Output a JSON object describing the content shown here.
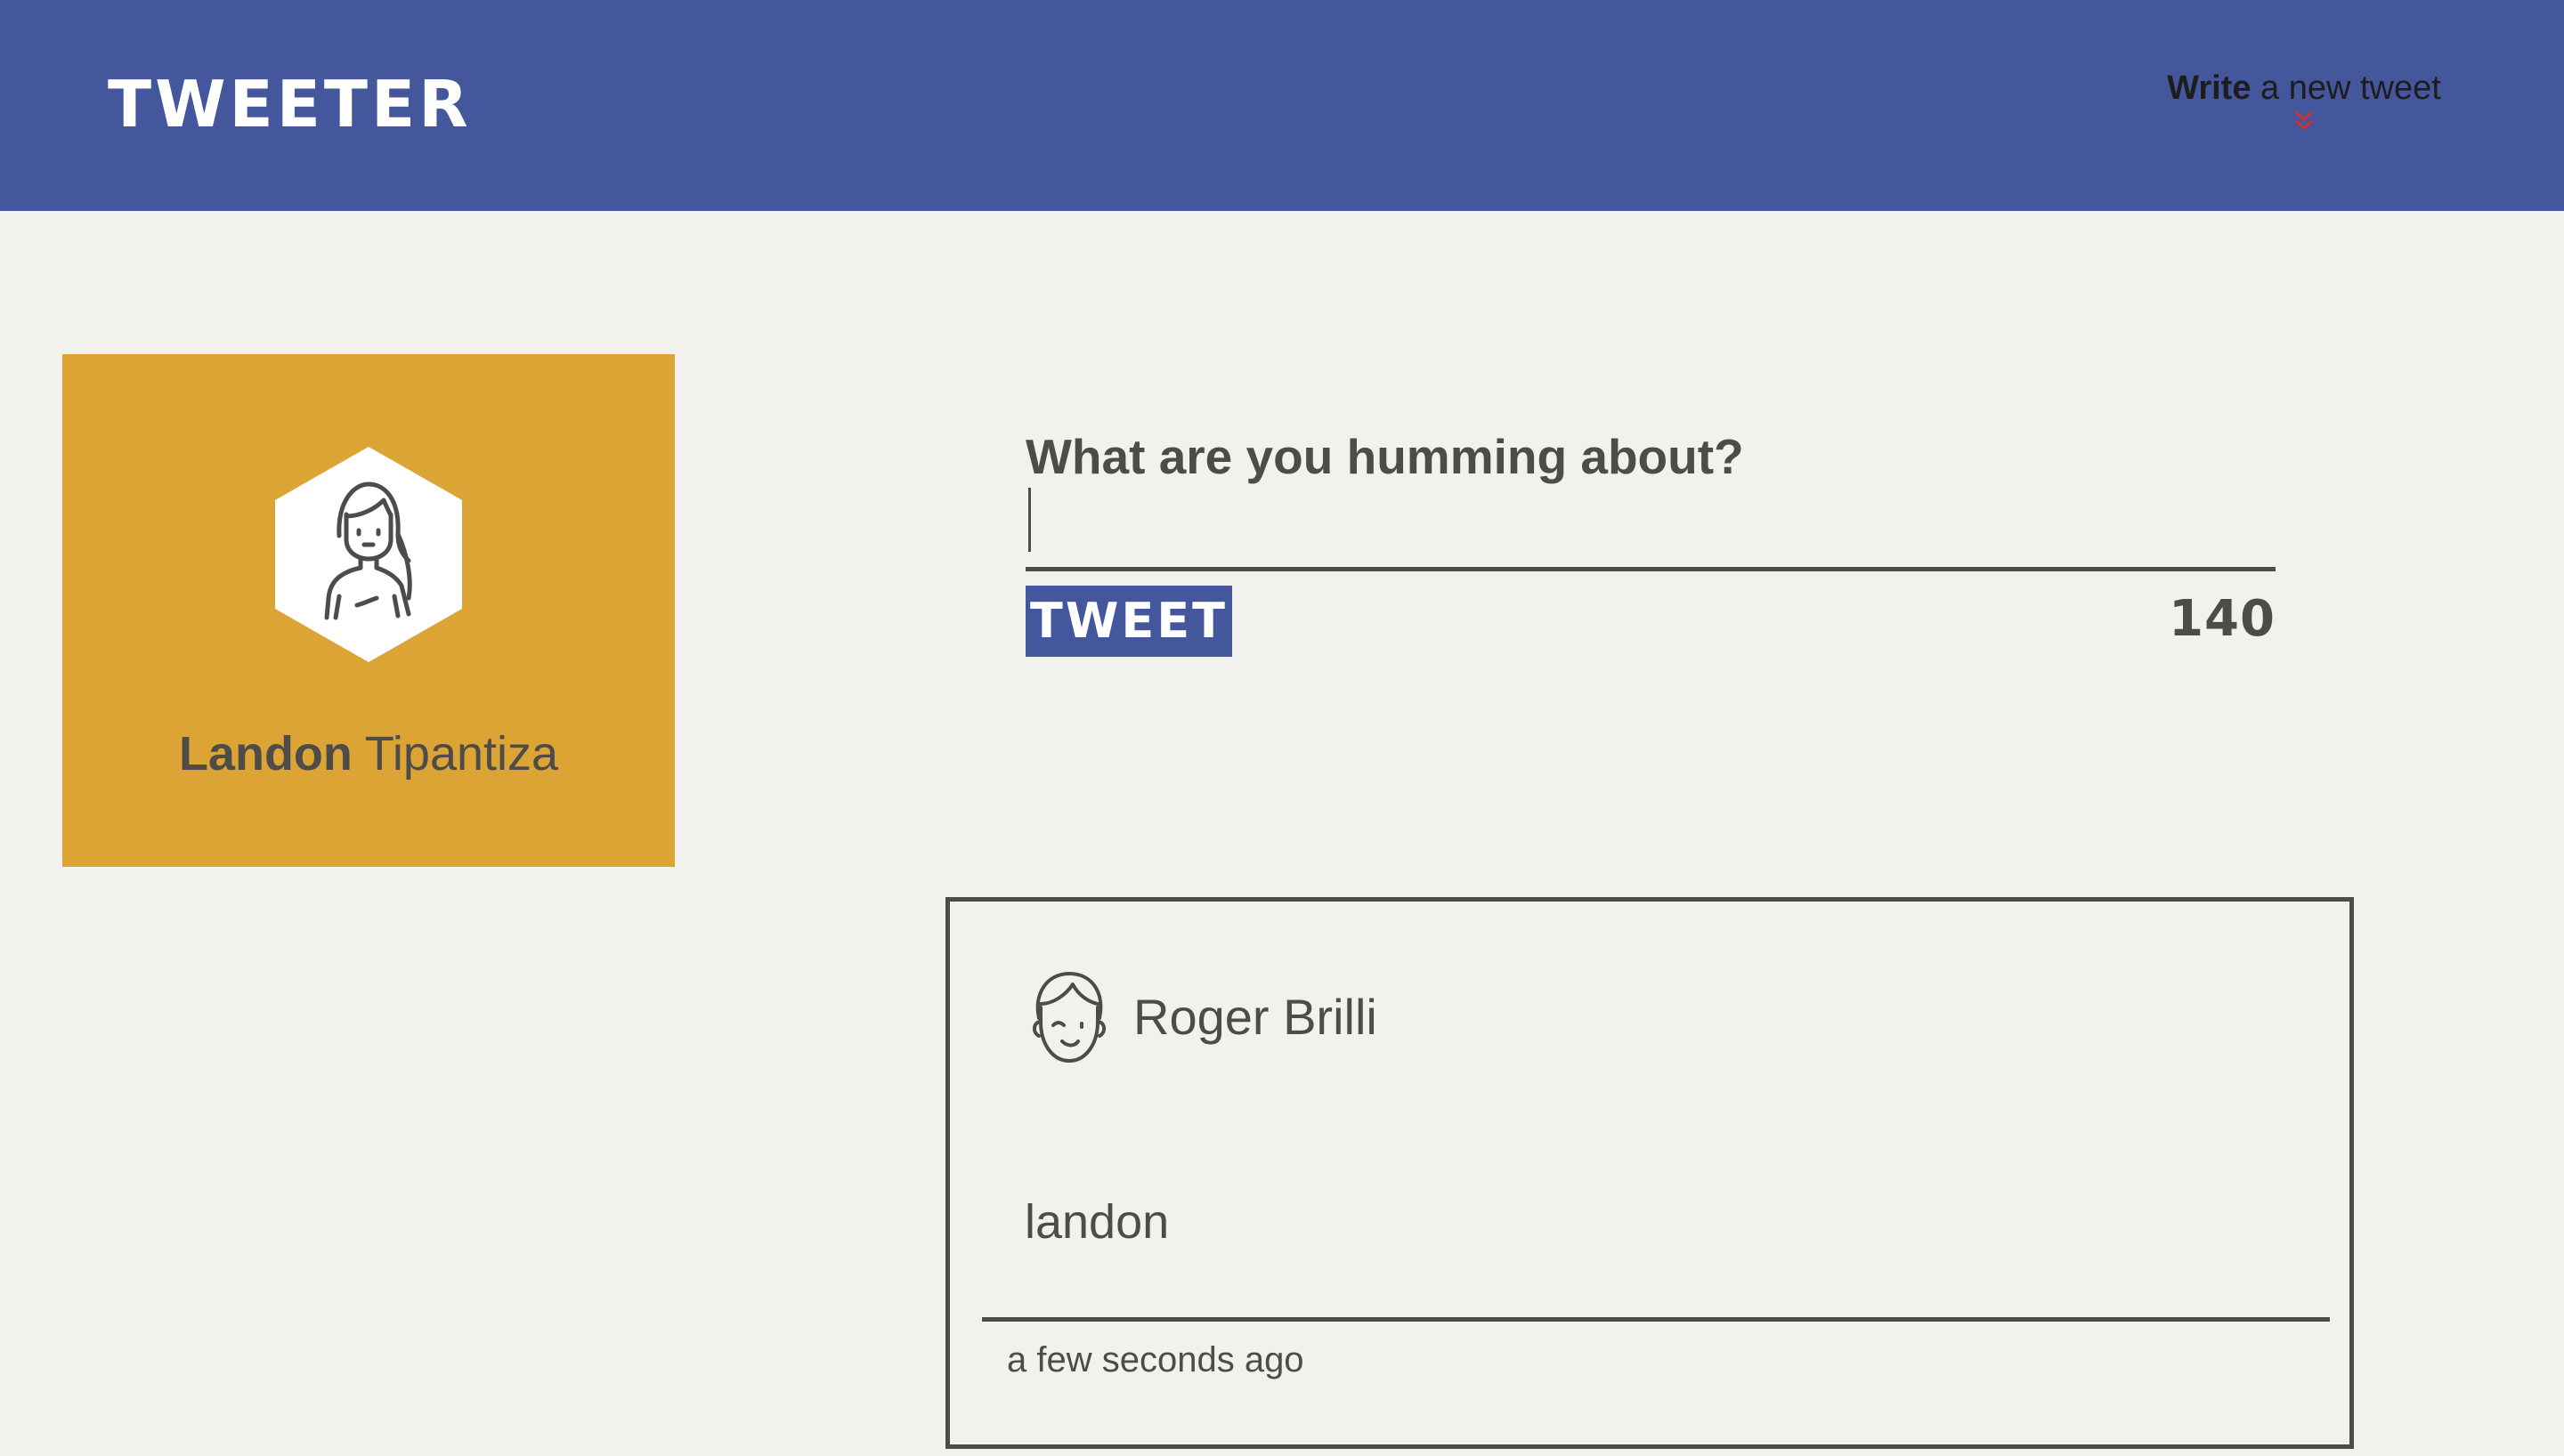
{
  "nav": {
    "logo": "TWEETER",
    "compose_toggle": {
      "bold": "Write",
      "rest": " a new tweet"
    }
  },
  "profile": {
    "first_name": "Landon",
    "last_name": " Tipantiza",
    "avatar_icon": "female-user-icon"
  },
  "compose": {
    "label": "What are you humming about?",
    "input_value": "",
    "button_label": "TWEET",
    "counter": "140"
  },
  "tweets": [
    {
      "author": "Roger Brilli",
      "avatar_icon": "male-user-icon",
      "text": "landon",
      "time": "a few seconds ago"
    }
  ],
  "colors": {
    "nav_bg": "#44569c",
    "page_bg": "#f3f1ed",
    "profile_bg": "#dba435",
    "text": "#4d4c49",
    "accent": "#d0312d"
  }
}
